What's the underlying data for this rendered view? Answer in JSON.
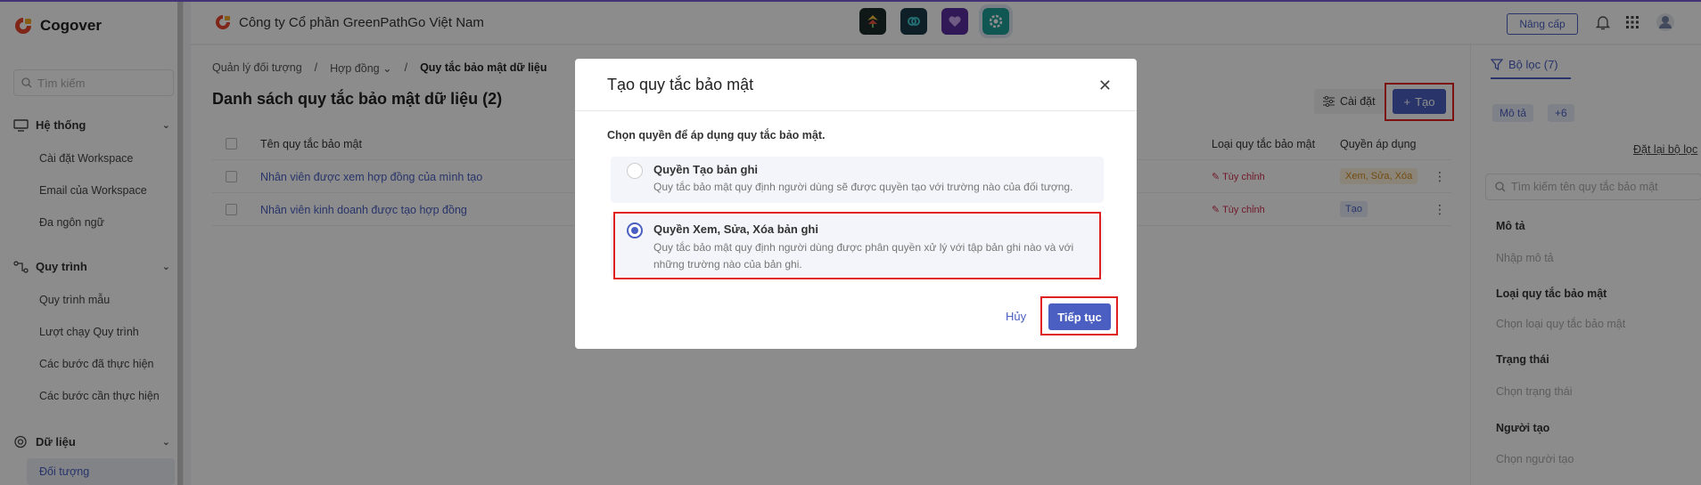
{
  "sidebar": {
    "brand": "Cogover",
    "search_placeholder": "Tìm kiếm",
    "sections": [
      {
        "label": "Hệ thống",
        "items": [
          "Cài đặt Workspace",
          "Email của Workspace",
          "Đa ngôn ngữ"
        ]
      },
      {
        "label": "Quy trình",
        "items": [
          "Quy trình mẫu",
          "Lượt chạy Quy trình",
          "Các bước đã thực hiện",
          "Các bước cần thực hiện"
        ]
      },
      {
        "label": "Dữ liệu",
        "items": [
          "Đối tượng"
        ]
      }
    ]
  },
  "header": {
    "company": "Công ty Cổ phần GreenPathGo Việt Nam",
    "upgrade": "Nâng cấp"
  },
  "main": {
    "breadcrumb": [
      "Quản lý đối tượng",
      "Hợp đồng",
      "Quy tắc bảo mật dữ liệu"
    ],
    "title": "Danh sách quy tắc bảo mật dữ liệu (2)",
    "settings_label": "Cài đặt",
    "create_label": "Tạo",
    "columns": [
      "Tên quy tắc bảo mật",
      "Loại quy tắc bảo mật",
      "Quyền áp dụng"
    ],
    "rows": [
      {
        "name": "Nhân viên được xem hợp đồng của mình tạo",
        "type": "Tùy chỉnh",
        "perm": "Xem, Sửa, Xóa"
      },
      {
        "name": "Nhân viên kinh doanh được tạo hợp đồng",
        "type": "Tùy chỉnh",
        "perm": "Tạo"
      }
    ]
  },
  "filter": {
    "title": "Bộ lọc (7)",
    "chip1": "Mô tả",
    "chip2": "+6",
    "reset": "Đặt lại bộ lọc",
    "search_placeholder": "Tìm kiếm tên quy tắc bảo mật",
    "fields": [
      {
        "label": "Mô tả",
        "placeholder": "Nhập mô tả"
      },
      {
        "label": "Loại quy tắc bảo mật",
        "placeholder": "Chọn loại quy tắc bảo mật"
      },
      {
        "label": "Trạng thái",
        "placeholder": "Chọn trạng thái"
      },
      {
        "label": "Người tạo",
        "placeholder": "Chọn người tạo"
      }
    ]
  },
  "modal": {
    "title": "Tạo quy tắc bảo mật",
    "prompt": "Chọn quyền để áp dụng quy tắc bảo mật.",
    "options": [
      {
        "title": "Quyền Tạo bản ghi",
        "desc": "Quy tắc bảo mật quy định người dùng sẽ được quyền tạo với trường nào của đối tượng.",
        "selected": false
      },
      {
        "title": "Quyền Xem, Sửa, Xóa bản ghi",
        "desc": "Quy tắc bảo mật quy định người dùng được phân quyền xử lý với tập bản ghi nào và với những trường nào của bản ghi.",
        "selected": true
      }
    ],
    "cancel": "Hủy",
    "next": "Tiếp tục"
  },
  "colors": {
    "accent": "#4a5fc1",
    "highlight": "#e02020",
    "tag_red": "#d03050"
  }
}
